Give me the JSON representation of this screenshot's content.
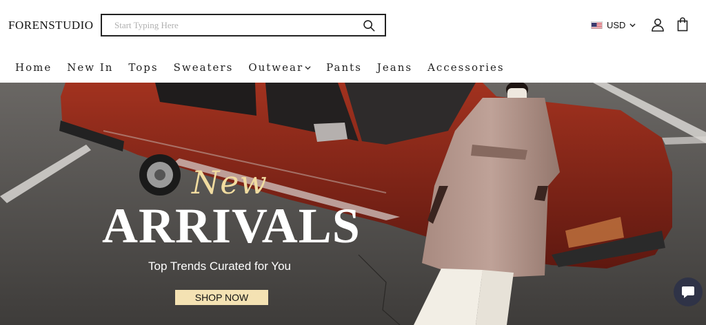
{
  "brand": {
    "logo_text": "FORENSTUDIO"
  },
  "search": {
    "placeholder": "Start Typing Here",
    "value": ""
  },
  "header": {
    "currency": "USD"
  },
  "nav": {
    "items": [
      {
        "label": "Home"
      },
      {
        "label": "New In"
      },
      {
        "label": "Tops"
      },
      {
        "label": "Sweaters"
      },
      {
        "label": "Outwear",
        "has_dropdown": true
      },
      {
        "label": "Pants"
      },
      {
        "label": "Jeans"
      },
      {
        "label": "Accessories"
      }
    ]
  },
  "hero": {
    "script_title": "New",
    "main_title": "ARRIVALS",
    "subtitle": "Top Trends Curated for You",
    "cta": "SHOP NOW"
  },
  "icons": {
    "search": "search-icon",
    "flag": "us-flag-icon",
    "currency_chevron": "chevron-down-icon",
    "account": "user-icon",
    "bag": "shopping-bag-icon",
    "chat": "chat-icon"
  },
  "colors": {
    "accent_cta": "#f4e2b3",
    "script_title": "#f1dca0",
    "chat_button": "#2f3347",
    "car_red": "#8f2418"
  }
}
